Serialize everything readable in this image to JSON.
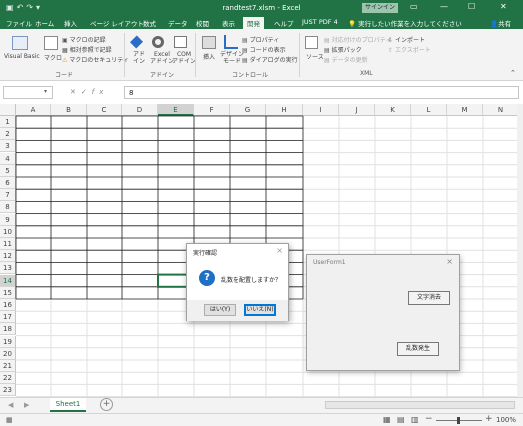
{
  "app": {
    "window_title": "randtest7.xlsm - Excel",
    "signin": "サインイン",
    "qat_icons": [
      "save-icon",
      "undo-icon",
      "redo-icon",
      "customize-icon"
    ]
  },
  "tabs": [
    "ファイル",
    "ホーム",
    "挿入",
    "ページ レイアウト",
    "数式",
    "データ",
    "校閲",
    "表示",
    "開発",
    "ヘルプ",
    "JUST PDF 4"
  ],
  "active_tab": "開発",
  "tellme": "実行したい作業を入力してください",
  "share": "共有",
  "ribbon": {
    "code_group": "コード",
    "visual_basic": "Visual Basic",
    "macro": "マクロ",
    "record_macro": "マクロの記録",
    "relative_ref": "相対参照で記録",
    "macro_security": "マクロのセキュリティ",
    "addin_group": "アドイン",
    "addins": "アド\nイン",
    "excel_addins": "Excel\nアドイン",
    "com_addins": "COM\nアドイン",
    "control_group": "コントロール",
    "insert": "挿入",
    "design_mode": "デザイン\nモード",
    "properties": "プロパティ",
    "view_code": "コードの表示",
    "run_dialog": "ダイアログの実行",
    "xml_group": "XML",
    "source": "ソース",
    "map_properties": "対応付けのプロパティ",
    "expansion_pack": "拡張パック",
    "refresh_data": "データの更新",
    "import": "インポート",
    "export": "エクスポート"
  },
  "formula_bar": {
    "name_box": "",
    "fx": "fx",
    "value": "8"
  },
  "grid": {
    "columns": [
      "A",
      "B",
      "C",
      "D",
      "E",
      "F",
      "G",
      "H",
      "I",
      "J",
      "K",
      "L",
      "M",
      "N"
    ],
    "rows": [
      "1",
      "2",
      "3",
      "4",
      "5",
      "6",
      "7",
      "8",
      "9",
      "10",
      "11",
      "12",
      "13",
      "14",
      "15",
      "16",
      "17",
      "18",
      "19",
      "20",
      "21",
      "22",
      "23"
    ],
    "selected_column": "E",
    "selected_row": "14"
  },
  "sheet": {
    "tab": "Sheet1",
    "add": "+"
  },
  "status": {
    "zoom": "100%"
  },
  "confirm_dialog": {
    "title": "実行確認",
    "close": "×",
    "icon": "?",
    "message": "乱数を配置しますか？",
    "yes": "はい(Y)",
    "no": "いいえ(N)"
  },
  "userform": {
    "title": "UserForm1",
    "close": "×",
    "clear_button": "文字消去",
    "generate_button": "乱数発生"
  },
  "colors": {
    "excel_green": "#217346",
    "dialog_blue": "#0078d7"
  }
}
